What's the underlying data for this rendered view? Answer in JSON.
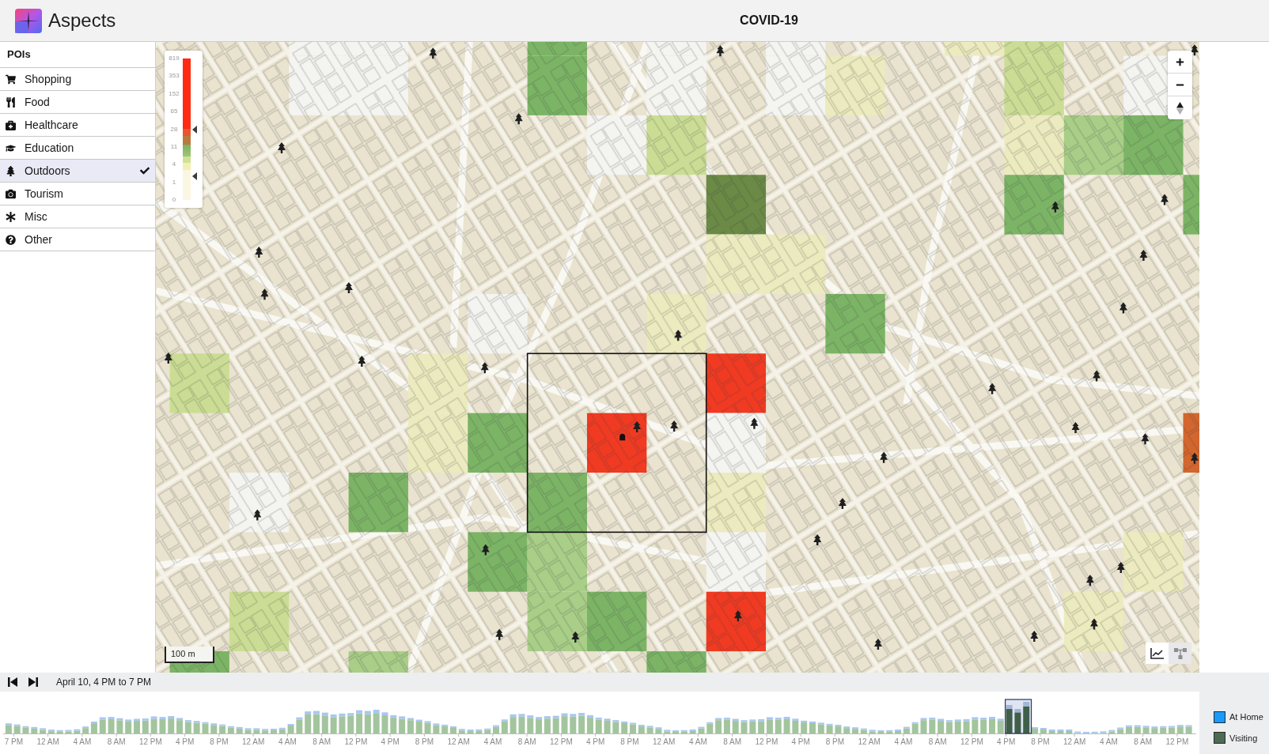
{
  "header": {
    "app_name": "Aspects",
    "title": "COVID-19"
  },
  "sidebar": {
    "heading": "POIs",
    "items": [
      {
        "label": "Shopping",
        "selected": false
      },
      {
        "label": "Food",
        "selected": false
      },
      {
        "label": "Healthcare",
        "selected": false
      },
      {
        "label": "Education",
        "selected": false
      },
      {
        "label": "Outdoors",
        "selected": true
      },
      {
        "label": "Tourism",
        "selected": false
      },
      {
        "label": "Misc",
        "selected": false
      },
      {
        "label": "Other",
        "selected": false
      }
    ]
  },
  "map": {
    "legend": {
      "ticks": [
        "819",
        "353",
        "152",
        "65",
        "28",
        "11",
        "4",
        "1",
        "0"
      ],
      "handles": [
        {
          "level": 0.5
        },
        {
          "level": 0.17
        }
      ]
    },
    "scale": "100 m",
    "heat_cells": [
      {
        "color": "#f4f4f1"
      },
      {
        "color": "#f4f4f1"
      },
      {
        "color": "#7cb466"
      },
      {
        "color": "#f4f4f1"
      },
      {
        "color": "#f4f4f1"
      },
      {
        "color": "#ecebbf"
      },
      {
        "color": "#cbdd95"
      },
      {
        "color": "#f4f4f1"
      },
      {
        "color": "#f4f4f1"
      },
      {
        "color": "#7cb466"
      },
      {
        "color": "#f4f4f1"
      },
      {
        "color": "#f4f4f1"
      },
      {
        "color": "#ecebbf"
      },
      {
        "color": "#cbdd95"
      },
      {
        "color": "#f4f4f1"
      },
      {
        "color": "#f4f4f1"
      },
      {
        "color": "#cbdd95"
      },
      {
        "color": "#ecebbf"
      },
      {
        "color": "#a9ce88"
      },
      {
        "color": "#7cb466"
      },
      {
        "color": "#6a8a46"
      },
      {
        "color": "#7cb466"
      },
      {
        "color": "#7cb466"
      },
      {
        "color": "#ecebbf"
      },
      {
        "color": "#ecebbf"
      },
      {
        "color": "#f4f4f1"
      },
      {
        "color": "#ecebbf"
      },
      {
        "color": "#7cb466"
      },
      {
        "color": "#cbdd95"
      },
      {
        "color": "#ecebbf"
      },
      {
        "color": "#f03a22"
      },
      {
        "color": "#ecebbf"
      },
      {
        "color": "#7cb466"
      },
      {
        "color": "#f03a22"
      },
      {
        "color": "#f4f4f1"
      },
      {
        "color": "#d2662e"
      },
      {
        "color": "#f4f4f1"
      },
      {
        "color": "#7cb466"
      },
      {
        "color": "#7cb466"
      },
      {
        "color": "#ecebbf"
      },
      {
        "color": "#7cb466"
      },
      {
        "color": "#a9ce88"
      },
      {
        "color": "#f4f4f1"
      },
      {
        "color": "#ecebbf"
      },
      {
        "color": "#cbdd95"
      },
      {
        "color": "#a9ce88"
      },
      {
        "color": "#7cb466"
      },
      {
        "color": "#f03a22"
      },
      {
        "color": "#ecebbf"
      },
      {
        "color": "#7cb466"
      },
      {
        "color": "#a9ce88"
      },
      {
        "color": "#7cb466"
      }
    ]
  },
  "timeline": {
    "range": "April 10, 4 PM to 7 PM",
    "x_labels": [
      "7 PM",
      "12 AM",
      "4 AM",
      "8 AM",
      "12 PM",
      "4 PM",
      "8 PM",
      "12 AM",
      "4 AM",
      "8 AM",
      "12 PM",
      "4 PM",
      "8 PM",
      "12 AM",
      "4 AM",
      "8 AM",
      "12 PM",
      "4 PM",
      "8 PM",
      "12 AM",
      "4 AM",
      "8 AM",
      "12 PM",
      "4 PM",
      "8 PM",
      "12 AM",
      "4 AM",
      "8 AM",
      "12 PM",
      "4 PM",
      "8 PM",
      "12 AM",
      "4 AM",
      "8 AM",
      "12 PM"
    ],
    "legend": [
      {
        "label": "At Home",
        "color": "#1a9bfc"
      },
      {
        "label": "Visiting",
        "color": "#4d6b52"
      }
    ]
  }
}
